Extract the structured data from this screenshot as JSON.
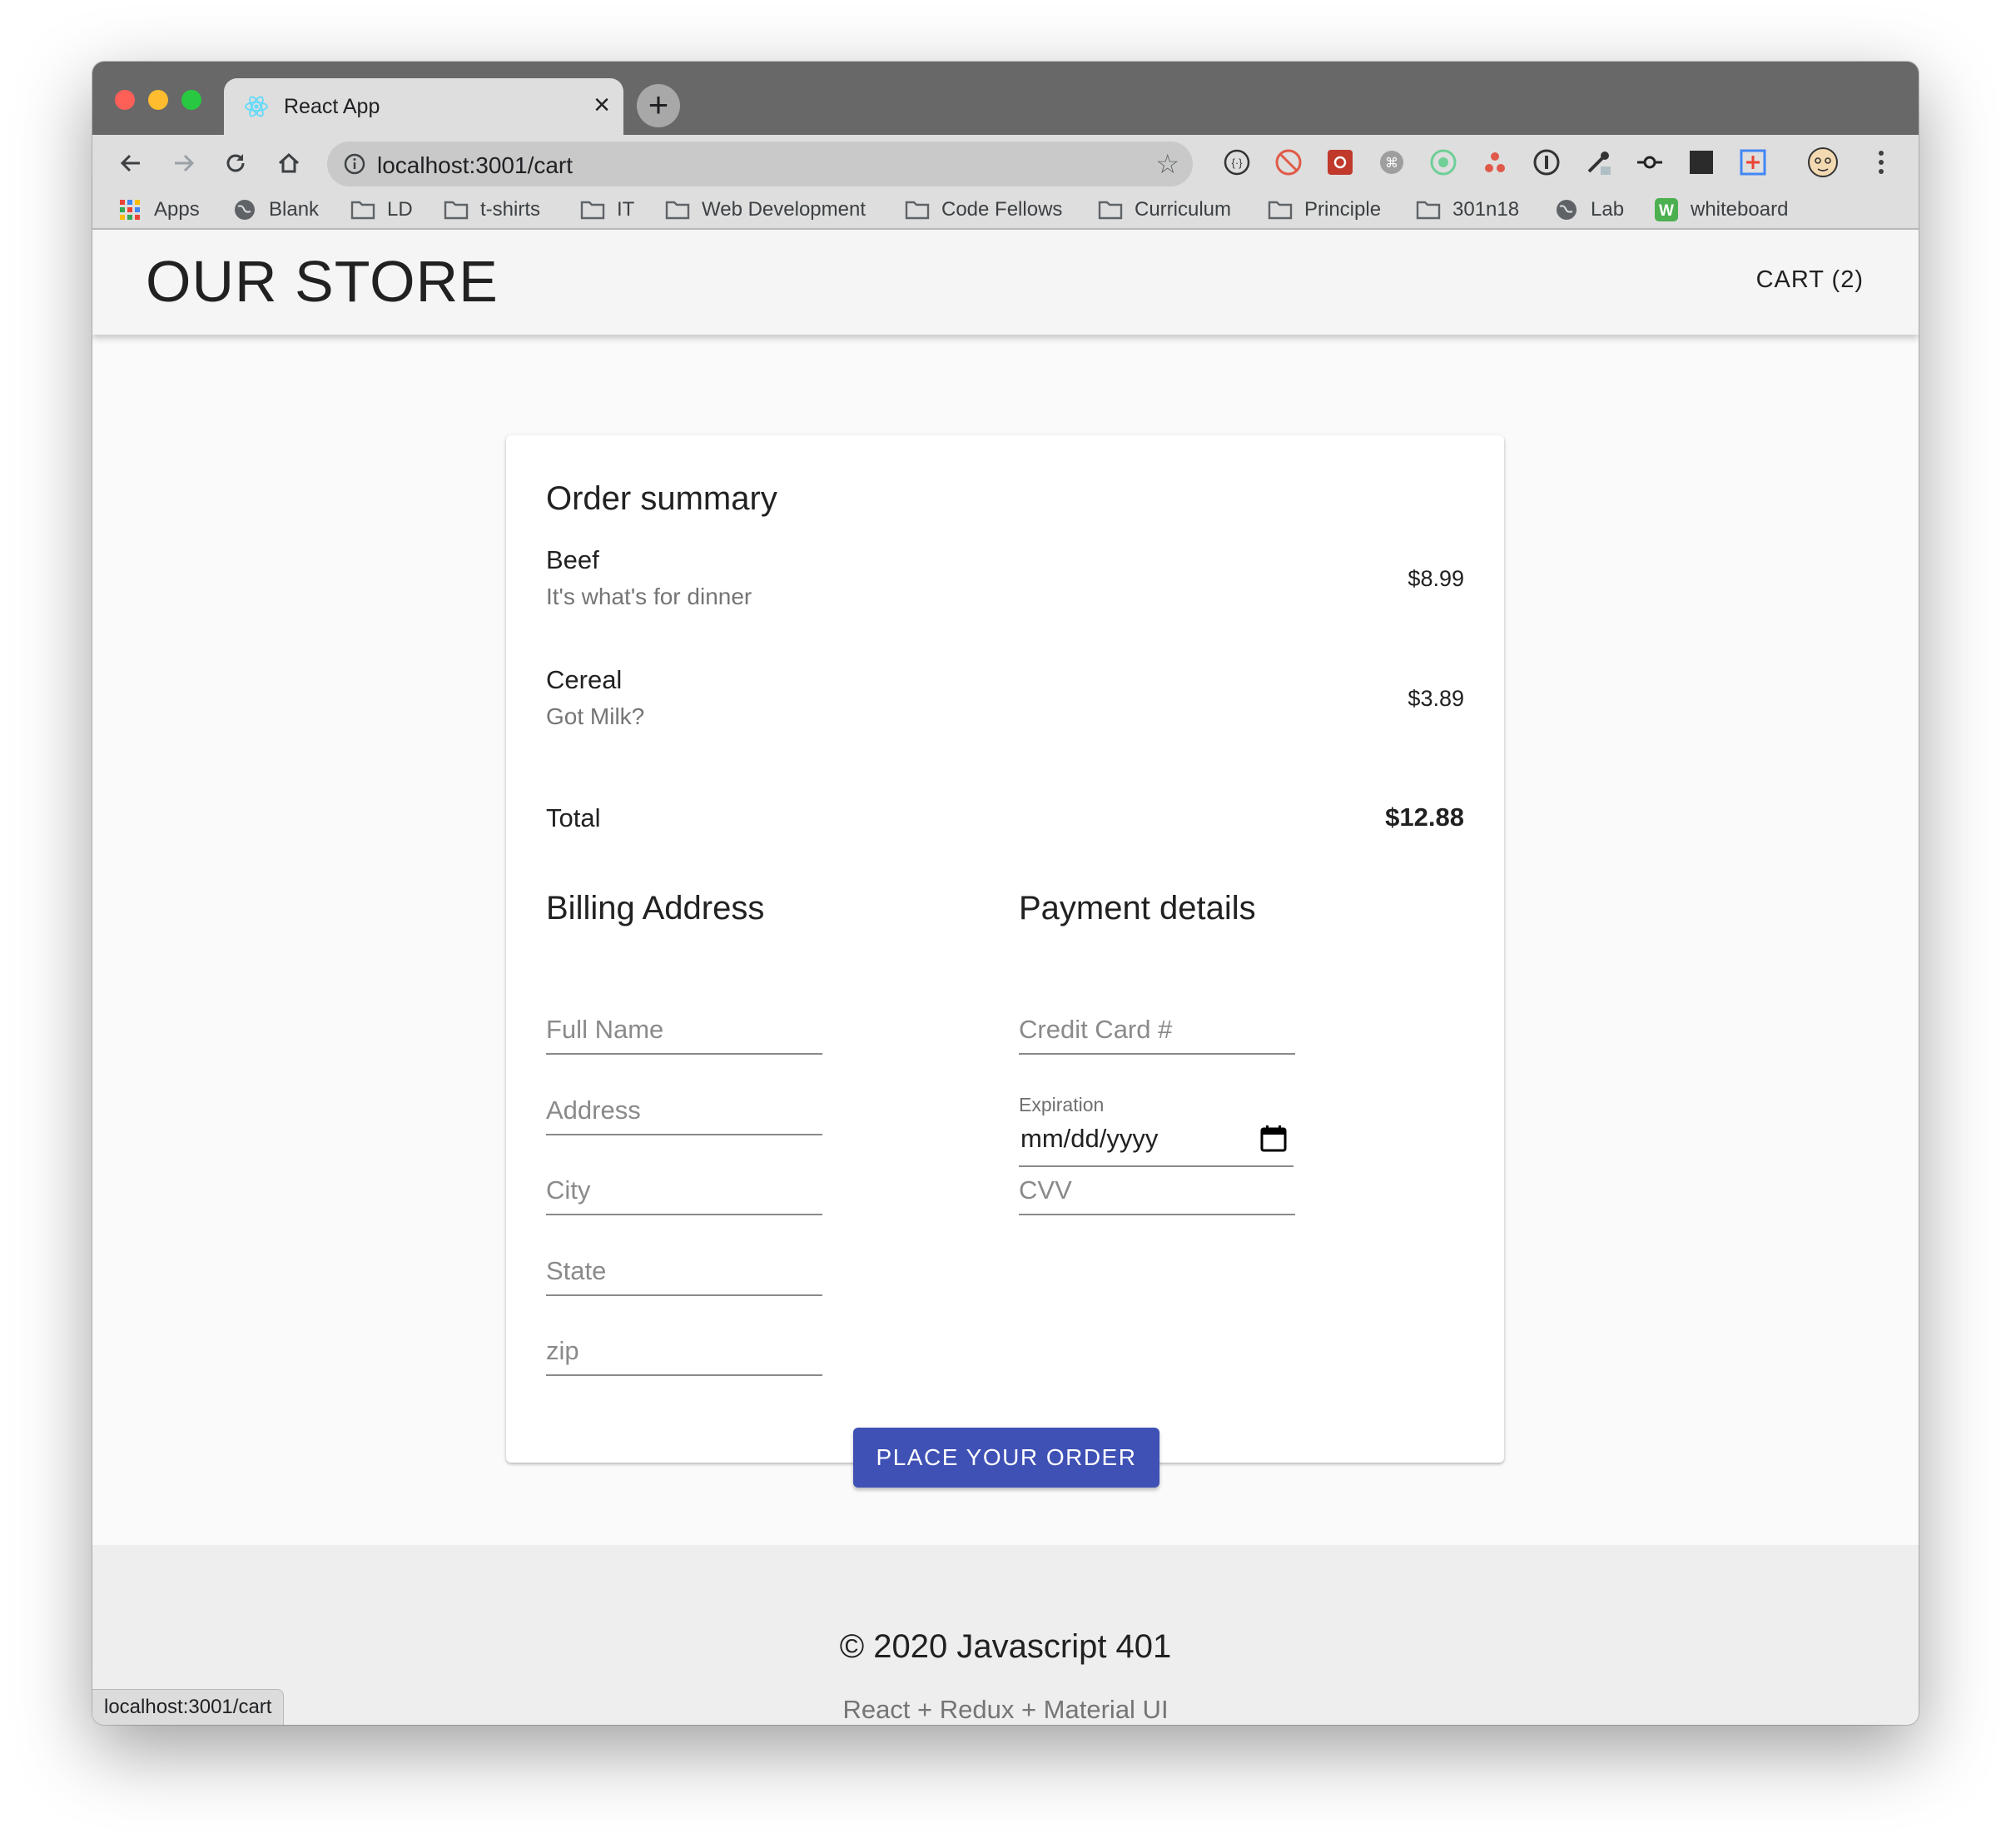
{
  "browser": {
    "tab_title": "React App",
    "url": "localhost:3001/cart",
    "status_url": "localhost:3001/cart",
    "bookmarks": [
      {
        "label": "Apps",
        "icon": "apps-grid-icon"
      },
      {
        "label": "Blank",
        "icon": "globe-icon"
      },
      {
        "label": "LD",
        "icon": "folder-icon"
      },
      {
        "label": "t-shirts",
        "icon": "folder-icon"
      },
      {
        "label": "IT",
        "icon": "folder-icon"
      },
      {
        "label": "Web Development",
        "icon": "folder-icon"
      },
      {
        "label": "Code Fellows",
        "icon": "folder-icon"
      },
      {
        "label": "Curriculum",
        "icon": "folder-icon"
      },
      {
        "label": "Principle",
        "icon": "folder-icon"
      },
      {
        "label": "301n18",
        "icon": "folder-icon"
      },
      {
        "label": "Lab",
        "icon": "globe-icon"
      },
      {
        "label": "whiteboard",
        "icon": "whiteboard-w-icon"
      }
    ]
  },
  "header": {
    "title": "OUR STORE",
    "cart_label": "CART (2)"
  },
  "order": {
    "heading": "Order summary",
    "items": [
      {
        "name": "Beef",
        "description": "It's what's for dinner",
        "price": "$8.99"
      },
      {
        "name": "Cereal",
        "description": "Got Milk?",
        "price": "$3.89"
      }
    ],
    "total_label": "Total",
    "total_value": "$12.88"
  },
  "billing": {
    "heading": "Billing Address",
    "fields": {
      "name": "Full Name",
      "address": "Address",
      "city": "City",
      "state": "State",
      "zip": "zip"
    }
  },
  "payment": {
    "heading": "Payment details",
    "card_placeholder": "Credit Card #",
    "expiration_label": "Expiration",
    "date_placeholder": "mm/dd/yyyy",
    "cvv_placeholder": "CVV"
  },
  "actions": {
    "place_order": "PLACE YOUR ORDER"
  },
  "footer": {
    "copyright": "© 2020 Javascript 401",
    "tagline": "React + Redux + Material UI"
  },
  "colors": {
    "primary": "#3f51b5",
    "appbar": "#f5f5f5",
    "page_bg": "#fafafa",
    "footer_bg": "#eeeeee"
  }
}
